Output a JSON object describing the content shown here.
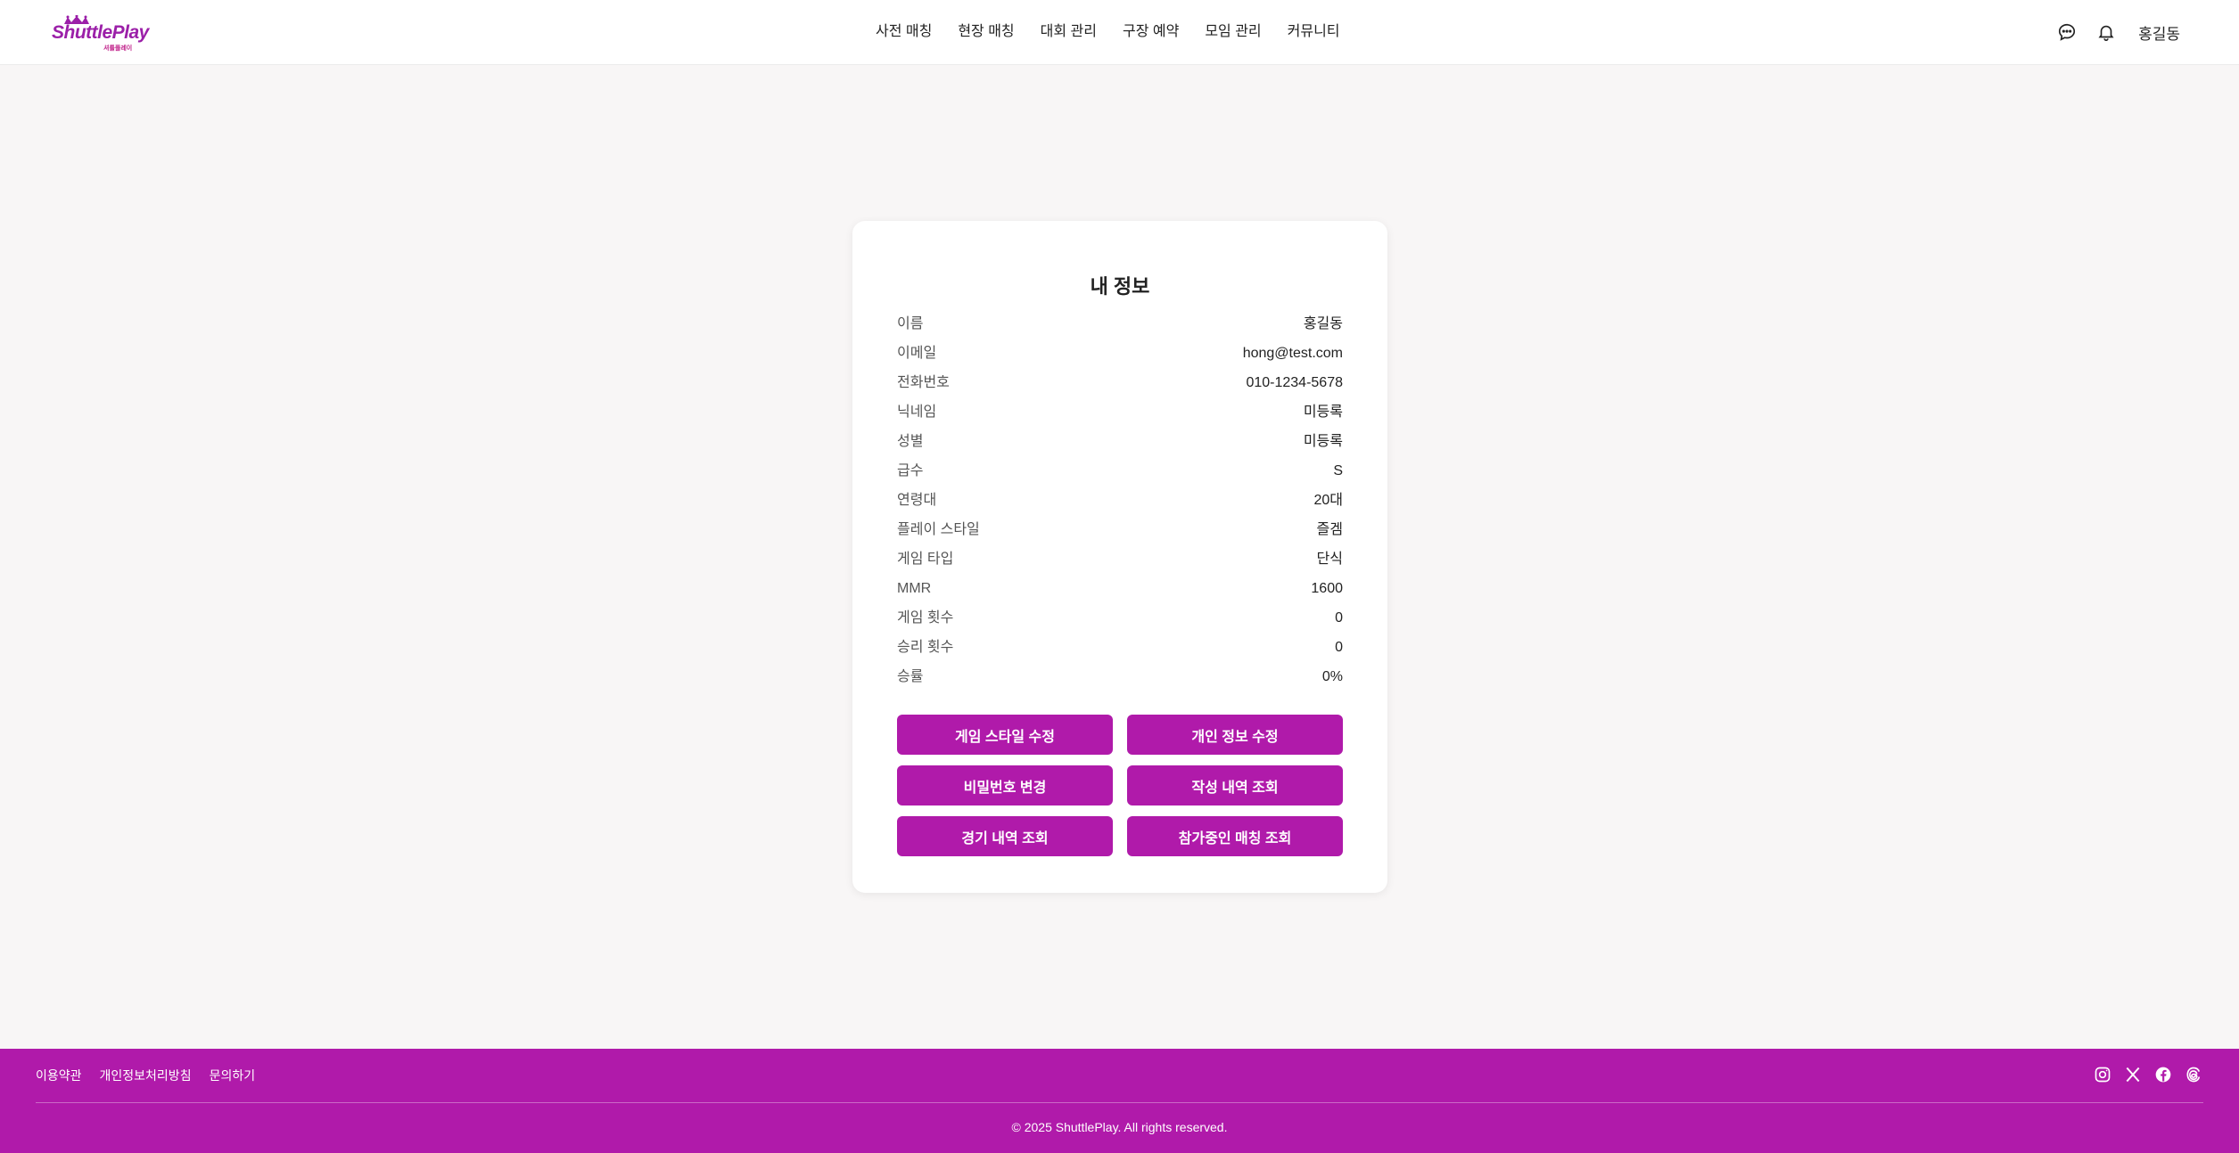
{
  "brand": {
    "logo_text": "ShuttlePlay",
    "logo_sub": "셔틀플레이",
    "accent_color": "#b01aaa"
  },
  "nav": {
    "items": [
      "사전 매칭",
      "현장 매칭",
      "대회 관리",
      "구장 예약",
      "모임 관리",
      "커뮤니티"
    ]
  },
  "header": {
    "icons": [
      "chat-icon",
      "bell-icon"
    ],
    "user_name": "홍길동"
  },
  "profile": {
    "title": "내 정보",
    "rows": [
      {
        "label": "이름",
        "value": "홍길동"
      },
      {
        "label": "이메일",
        "value": "hong@test.com"
      },
      {
        "label": "전화번호",
        "value": "010-1234-5678"
      },
      {
        "label": "닉네임",
        "value": "미등록"
      },
      {
        "label": "성별",
        "value": "미등록"
      },
      {
        "label": "급수",
        "value": "S"
      },
      {
        "label": "연령대",
        "value": "20대"
      },
      {
        "label": "플레이 스타일",
        "value": "즐겜"
      },
      {
        "label": "게임 타입",
        "value": "단식"
      },
      {
        "label": "MMR",
        "value": "1600"
      },
      {
        "label": "게임 횟수",
        "value": "0"
      },
      {
        "label": "승리 횟수",
        "value": "0"
      },
      {
        "label": "승률",
        "value": "0%"
      }
    ],
    "buttons": [
      "게임 스타일 수정",
      "개인 정보 수정",
      "비밀번호 변경",
      "작성 내역 조회",
      "경기 내역 조회",
      "참가중인 매칭 조회"
    ]
  },
  "footer": {
    "links": [
      "이용약관",
      "개인정보처리방침",
      "문의하기"
    ],
    "social": [
      "instagram-icon",
      "x-icon",
      "facebook-icon",
      "threads-icon"
    ],
    "copyright": "© 2025 ShuttlePlay. All rights reserved."
  }
}
